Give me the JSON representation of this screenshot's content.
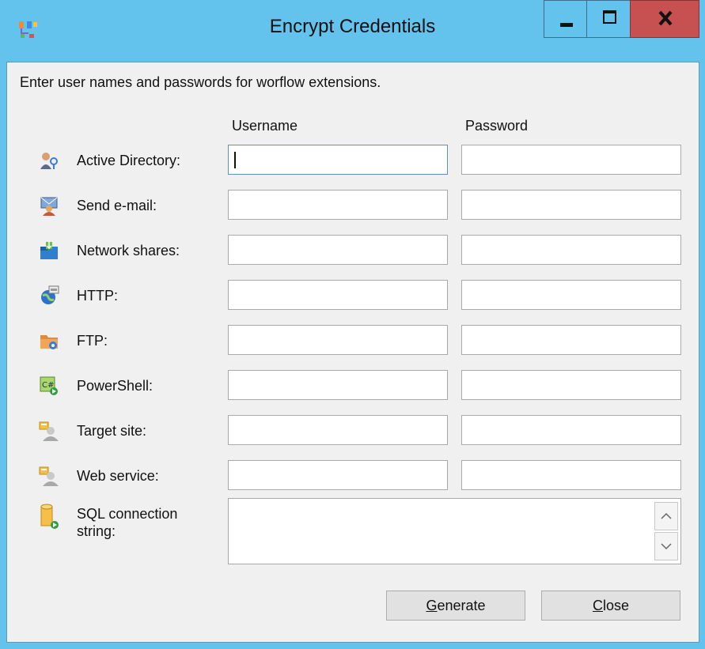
{
  "window": {
    "title": "Encrypt Credentials"
  },
  "instruction": "Enter user names and passwords for worflow extensions.",
  "columns": {
    "username": "Username",
    "password": "Password"
  },
  "rows": [
    {
      "label": "Active Directory:",
      "icon": "active-directory-icon",
      "username": "",
      "password": ""
    },
    {
      "label": "Send e-mail:",
      "icon": "send-email-icon",
      "username": "",
      "password": ""
    },
    {
      "label": "Network shares:",
      "icon": "network-shares-icon",
      "username": "",
      "password": ""
    },
    {
      "label": "HTTP:",
      "icon": "http-icon",
      "username": "",
      "password": ""
    },
    {
      "label": "FTP:",
      "icon": "ftp-icon",
      "username": "",
      "password": ""
    },
    {
      "label": "PowerShell:",
      "icon": "powershell-icon",
      "username": "",
      "password": ""
    },
    {
      "label": "Target site:",
      "icon": "target-site-icon",
      "username": "",
      "password": ""
    },
    {
      "label": "Web service:",
      "icon": "web-service-icon",
      "username": "",
      "password": ""
    }
  ],
  "sql": {
    "label_line1": "SQL connection",
    "label_line2": "string:",
    "icon": "sql-database-icon",
    "value": ""
  },
  "buttons": {
    "generate": {
      "mnemonic": "G",
      "rest": "enerate"
    },
    "close": {
      "mnemonic": "C",
      "rest": "lose"
    }
  },
  "colors": {
    "titlebar": "#63c3ec",
    "close_button": "#c75050",
    "client_bg": "#f0f0f0"
  }
}
